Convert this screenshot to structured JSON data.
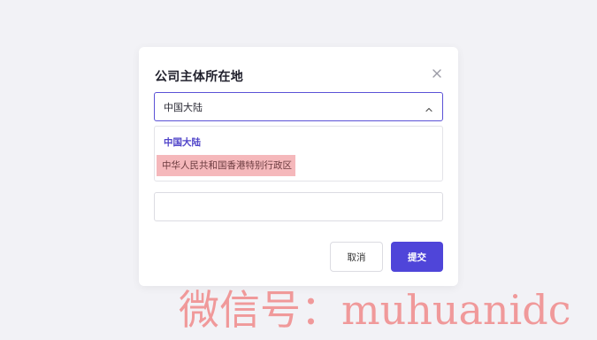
{
  "modal": {
    "title": "公司主体所在地",
    "select_value": "中国大陆",
    "options": [
      {
        "label": "中国大陆",
        "state": "selected"
      },
      {
        "label": "中华人民共和国香港特别行政区",
        "state": "highlighted"
      }
    ],
    "input_value": "",
    "cancel_label": "取消",
    "submit_label": "提交"
  },
  "icons": {
    "close": "close-icon",
    "chevron": "chevron-up-icon"
  },
  "colors": {
    "accent": "#4f45d9",
    "selected_text": "#5044c9",
    "highlight_bg": "#f5b8bb",
    "watermark": "#f08a8a"
  },
  "watermark": "微信号：muhuanidc"
}
